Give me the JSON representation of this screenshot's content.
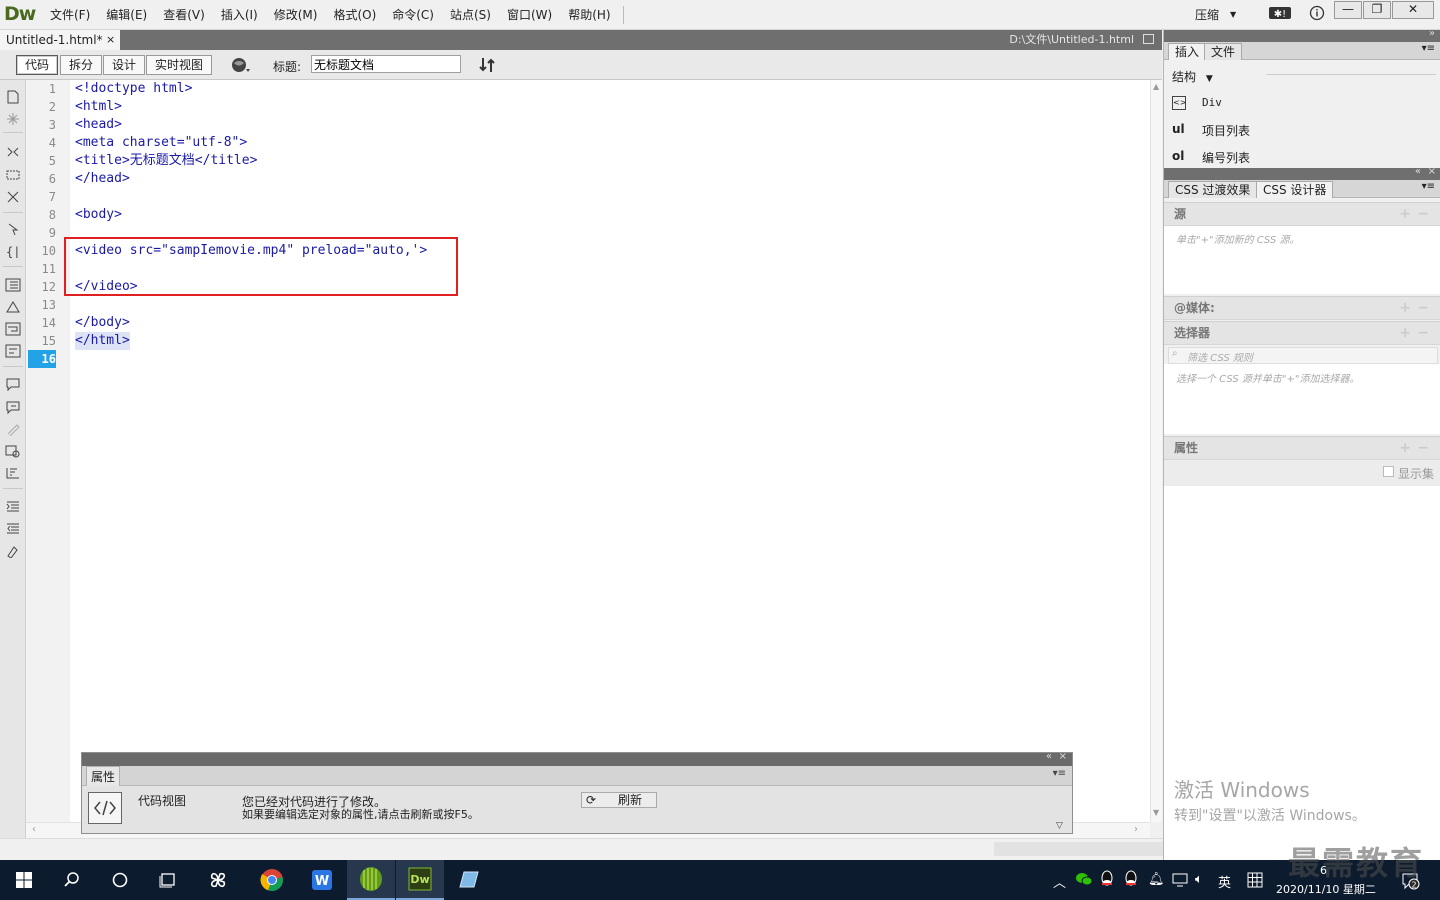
{
  "app": {
    "logo": "Dw",
    "menus": [
      "文件(F)",
      "编辑(E)",
      "查看(V)",
      "插入(I)",
      "修改(M)",
      "格式(O)",
      "命令(C)",
      "站点(S)",
      "窗口(W)",
      "帮助(H)"
    ],
    "workspace": "压缩",
    "window_controls": {
      "minimize": "—",
      "restore": "❐",
      "close": "✕"
    }
  },
  "document": {
    "tab_label": "Untitled-1.html*",
    "tab_close": "×",
    "path": "D:\\文件\\Untitled-1.html",
    "view_buttons": [
      "代码",
      "拆分",
      "设计",
      "实时视图"
    ],
    "title_label": "标题:",
    "title_value": "无标题文档"
  },
  "code": {
    "lines": [
      "<!doctype html>",
      "<html>",
      "<head>",
      "<meta charset=\"utf-8\">",
      "<title>无标题文档</title>",
      "</head>",
      "",
      "<body>",
      "",
      "<video src=\"sampIemovie.mp4\" preload=\"auto,'>",
      "",
      "</video>",
      "",
      "</body>",
      "</html>",
      ""
    ],
    "line_numbers": [
      "1",
      "2",
      "3",
      "4",
      "5",
      "6",
      "7",
      "8",
      "9",
      "10",
      "11",
      "12",
      "13",
      "14",
      "15",
      "16"
    ],
    "current_line": "16"
  },
  "properties": {
    "tab_label": "属性",
    "view_label": "代码视图",
    "message_line1": "您已经对代码进行了修改。",
    "message_line2": "如果要编辑选定对象的属性,请点击刷新或按F5。",
    "refresh_label": "刷新"
  },
  "insert_panel": {
    "tabs": [
      "插入",
      "文件"
    ],
    "category": "结构",
    "items": [
      {
        "icon_text": "<>",
        "label": "Div"
      },
      {
        "icon_text": "ul",
        "label": "项目列表"
      },
      {
        "icon_text": "ol",
        "label": "编号列表"
      }
    ]
  },
  "css_panel": {
    "tabs": [
      "CSS 过渡效果",
      "CSS 设计器"
    ],
    "source_head": "源",
    "source_hint": "单击\"+\"添加新的 CSS 源。",
    "media_head": "@媒体:",
    "selector_head": "选择器",
    "selector_filter_placeholder": "筛选 CSS 规则",
    "selector_hint": "选择一个 CSS 源并单击\"+\"添加选择器。",
    "properties_head": "属性",
    "show_set_label": "显示集"
  },
  "watermark": {
    "activate_title": "激活 Windows",
    "activate_sub": "转到\"设置\"以激活 Windows。",
    "brand": "最需教育"
  },
  "taskbar": {
    "ime": "英",
    "date": "2020/11/10 星期二",
    "time_partial": "6"
  }
}
